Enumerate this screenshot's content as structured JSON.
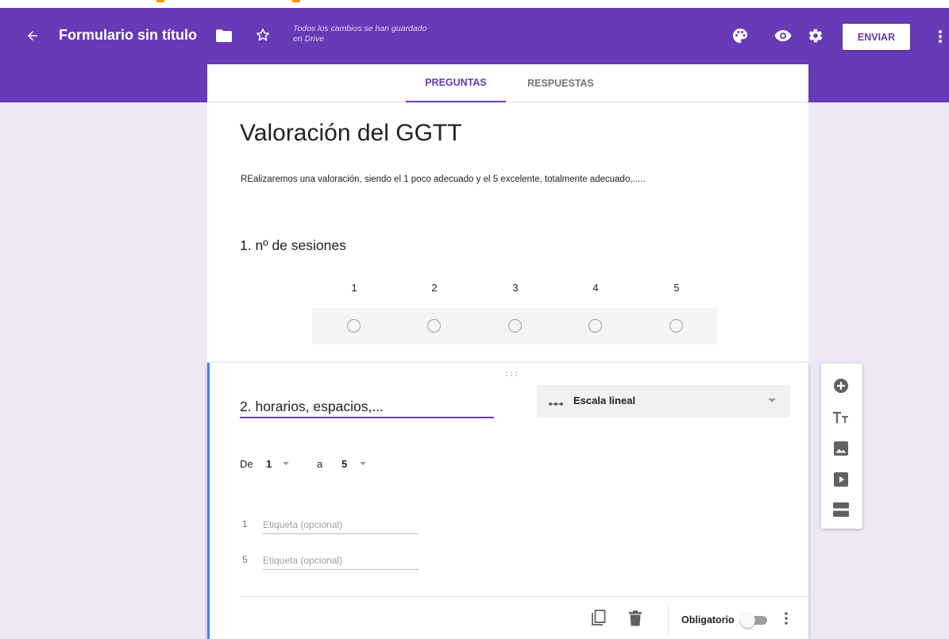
{
  "colors": {
    "brand": "#673ab7",
    "background": "#ede7f6",
    "accent_blue": "#4285f4"
  },
  "header": {
    "form_title": "Formulario sin título",
    "saved_note": "Todos los cambios se han guardado en Drive",
    "send_label": "ENVIAR",
    "icons": [
      "back-arrow-icon",
      "folder-icon",
      "star-icon",
      "palette-icon",
      "eye-icon",
      "gear-icon",
      "more-vert-icon"
    ]
  },
  "tabs": [
    {
      "label": "PREGUNTAS",
      "active": true
    },
    {
      "label": "RESPUESTAS",
      "active": false
    }
  ],
  "form": {
    "title": "Valoración del GGTT",
    "description": "REalizaremos una valoración, siendo el 1 poco adecuado y el 5 excelente, totalmente adecuado,....."
  },
  "question1": {
    "title": "1. nº de sesiones",
    "scale": [
      "1",
      "2",
      "3",
      "4",
      "5"
    ]
  },
  "question2": {
    "title": "2. horarios, espacios,...",
    "type_label": "Escala lineal",
    "range": {
      "from_label": "De",
      "from_value": "1",
      "to_label": "a",
      "to_value": "5"
    },
    "labels": [
      {
        "num": "1",
        "placeholder": "Etiqueta (opcional)"
      },
      {
        "num": "5",
        "placeholder": "Etiqueta (opcional)"
      }
    ],
    "required_label": "Obligatorio",
    "required": false
  },
  "side_toolbar": {
    "tools": [
      "add-question-icon",
      "title-text-icon",
      "image-icon",
      "video-icon",
      "section-icon"
    ]
  }
}
